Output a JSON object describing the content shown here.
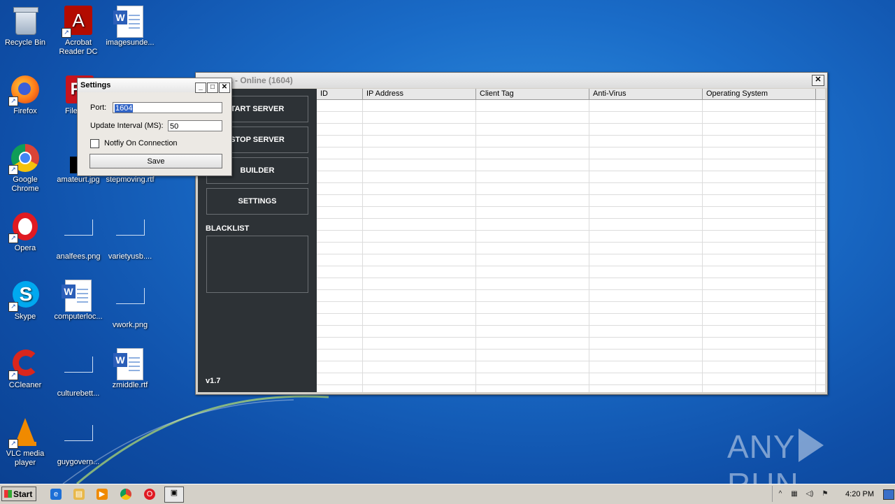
{
  "desktop": {
    "icons": [
      {
        "label": "Recycle Bin",
        "icon": "recycle-bin-icon"
      },
      {
        "label": "Acrobat Reader DC",
        "icon": "acrobat-icon"
      },
      {
        "label": "imagesunde...",
        "icon": "word-doc-icon"
      },
      {
        "label": "Firefox",
        "icon": "firefox-icon"
      },
      {
        "label": "FileZilla",
        "icon": "filezilla-icon"
      },
      {
        "label": "Google Chrome",
        "icon": "chrome-icon"
      },
      {
        "label": "amateurt.jpg",
        "icon": "image-file-icon"
      },
      {
        "label": "stepmoving.rtf",
        "icon": "word-doc-icon"
      },
      {
        "label": "Opera",
        "icon": "opera-icon"
      },
      {
        "label": "analfees.png",
        "icon": "image-file-icon"
      },
      {
        "label": "varietyusb....",
        "icon": "image-file-icon"
      },
      {
        "label": "Skype",
        "icon": "skype-icon"
      },
      {
        "label": "computerloc...",
        "icon": "word-doc-icon"
      },
      {
        "label": "vwork.png",
        "icon": "image-file-icon"
      },
      {
        "label": "CCleaner",
        "icon": "ccleaner-icon"
      },
      {
        "label": "culturebett...",
        "icon": "image-file-icon"
      },
      {
        "label": "zmiddle.rtf",
        "icon": "word-doc-icon"
      },
      {
        "label": "VLC media player",
        "icon": "vlc-icon"
      },
      {
        "label": "guygovern...",
        "icon": "image-file-icon"
      }
    ]
  },
  "app": {
    "title": "at - Online (1604)",
    "close": "✕",
    "buttons": {
      "start": "TART SERVER",
      "stop": "STOP SERVER",
      "builder": "BUILDER",
      "settings": "SETTINGS"
    },
    "blacklist_label": "BLACKLIST",
    "version": "v1.7",
    "columns": [
      "ID",
      "IP Address",
      "Client Tag",
      "Anti-Virus",
      "Operating System"
    ]
  },
  "settings_dialog": {
    "title": "Settings",
    "port_label": "Port:",
    "port_value": "1604",
    "interval_label": "Update Interval (MS):",
    "interval_value": "50",
    "notify_label": "Notfiy On Connection",
    "notify_checked": false,
    "save_label": "Save"
  },
  "watermark": {
    "left": "ANY",
    "right": "RUN"
  },
  "taskbar": {
    "start_label": "Start",
    "clock": "4:20 PM",
    "quick_launch": [
      "ie-icon",
      "explorer-icon",
      "media-player-icon",
      "chrome-icon",
      "opera-icon",
      "app-window-icon"
    ],
    "tray_icons": [
      "tray-arrow-icon",
      "network-icon",
      "volume-icon",
      "flag-icon"
    ]
  },
  "colors": {
    "sidebar": "#2d3236",
    "selection": "#3063c6",
    "desktop": "#1a6cc8"
  }
}
